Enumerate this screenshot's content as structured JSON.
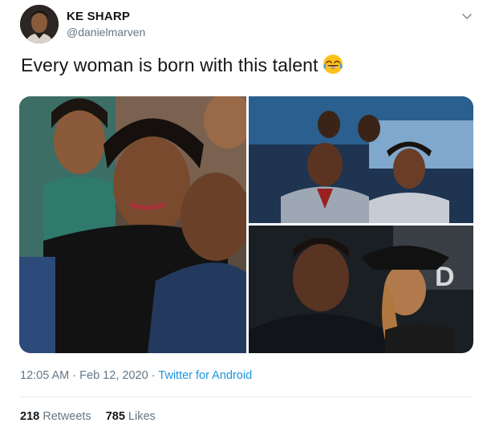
{
  "user": {
    "display_name": "KE SHARP",
    "handle": "@danielmarven"
  },
  "tweet": {
    "text": "Every woman is born with this talent",
    "emoji": "face-with-tears-of-joy"
  },
  "meta": {
    "time": "12:05 AM",
    "separator": "·",
    "date": "Feb 12, 2020",
    "source": "Twitter for Android"
  },
  "stats": {
    "retweets_count": "218",
    "retweets_label": "Retweets",
    "likes_count": "785",
    "likes_label": "Likes"
  },
  "colors": {
    "text_primary": "#14171a",
    "text_secondary": "#657786",
    "link": "#1b95e0",
    "divider": "#e6ecf0"
  }
}
